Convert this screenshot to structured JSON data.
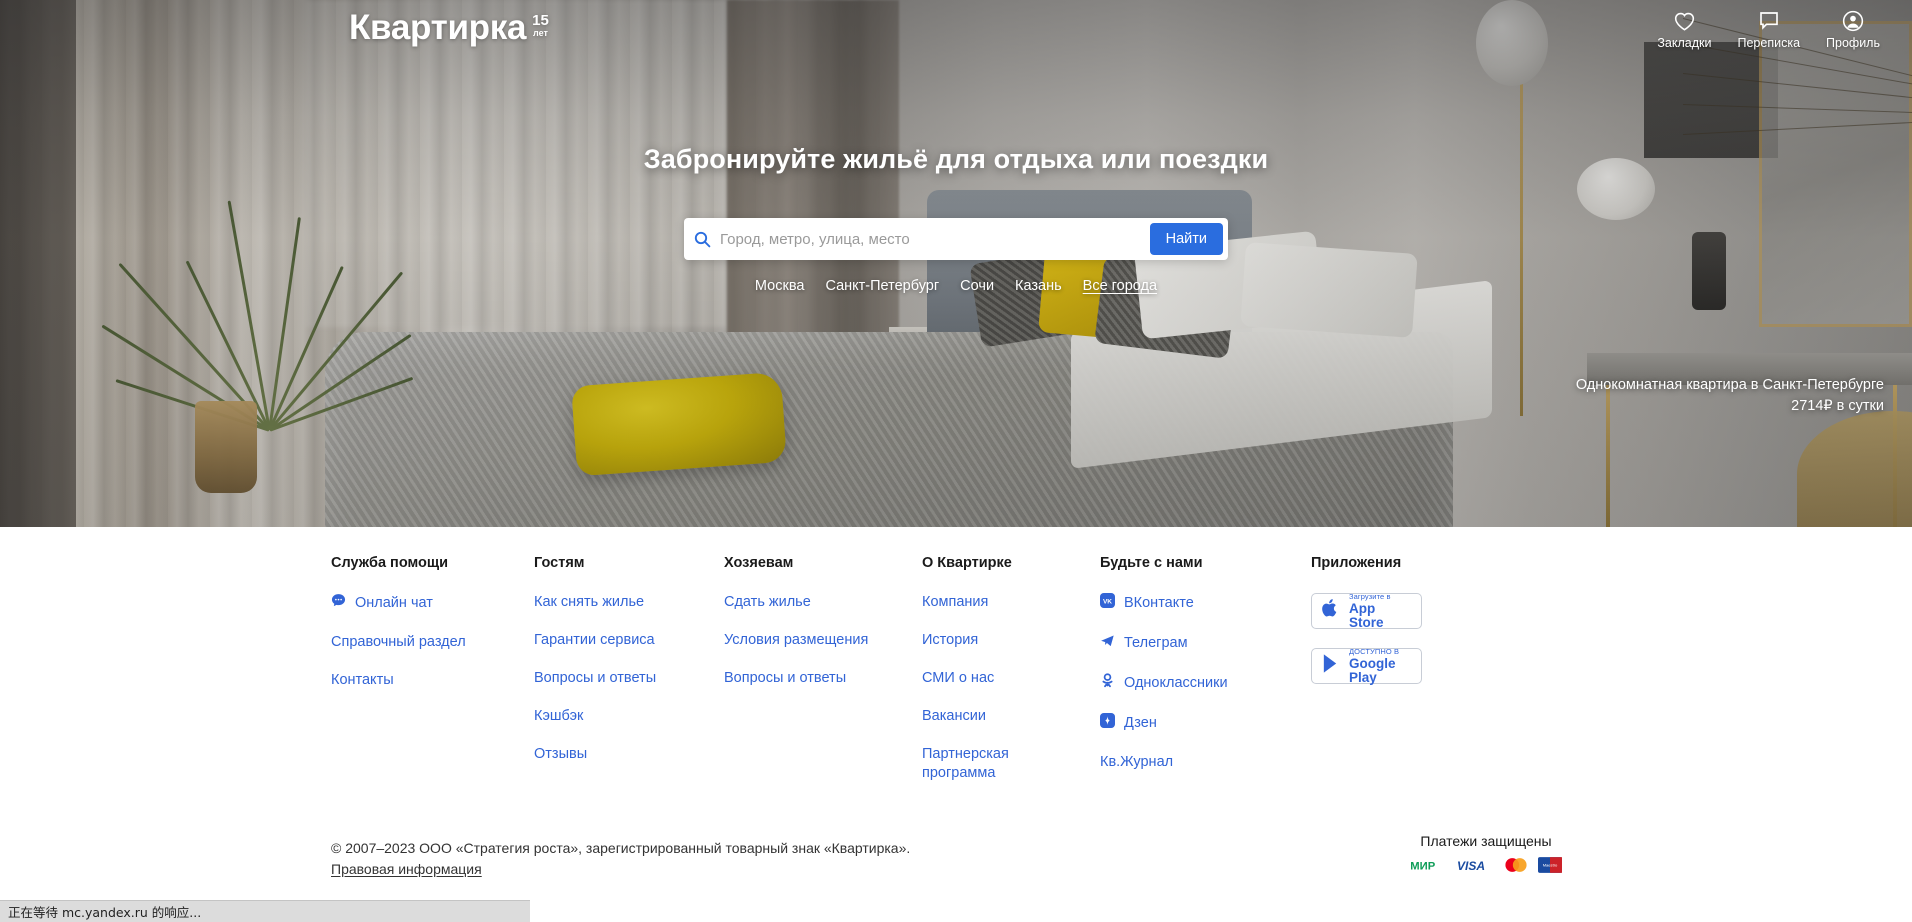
{
  "header": {
    "logo_word": "Квартирка",
    "logo_badge_number": "15",
    "logo_badge_unit": "лет",
    "nav": [
      {
        "icon": "heart-icon",
        "label": "Закладки"
      },
      {
        "icon": "chat-bubble-icon",
        "label": "Переписка"
      },
      {
        "icon": "user-circle-icon",
        "label": "Профиль"
      }
    ]
  },
  "hero": {
    "title": "Забронируйте жильё для отдыха или поездки",
    "search": {
      "icon": "search-icon",
      "placeholder": "Город, метро, улица, место",
      "value": "",
      "button_label": "Найти"
    },
    "cities": [
      "Москва",
      "Санкт-Петербург",
      "Сочи",
      "Казань",
      "Все города"
    ],
    "caption_line1": "Однокомнатная квартира в Санкт-Петербурге",
    "caption_line2": "2714₽ в сутки"
  },
  "footer": {
    "columns": [
      {
        "title": "Служба помощи",
        "links": [
          {
            "label": "Онлайн чат",
            "icon": "chat-filled-icon"
          },
          {
            "label": "Справочный раздел",
            "icon": ""
          },
          {
            "label": "Контакты",
            "icon": ""
          }
        ]
      },
      {
        "title": "Гостям",
        "links": [
          {
            "label": "Как снять жилье",
            "icon": ""
          },
          {
            "label": "Гарантии сервиса",
            "icon": ""
          },
          {
            "label": "Вопросы и ответы",
            "icon": ""
          },
          {
            "label": "Кэшбэк",
            "icon": ""
          },
          {
            "label": "Отзывы",
            "icon": ""
          }
        ]
      },
      {
        "title": "Хозяевам",
        "links": [
          {
            "label": "Сдать жилье",
            "icon": ""
          },
          {
            "label": "Условия размещения",
            "icon": ""
          },
          {
            "label": "Вопросы и ответы",
            "icon": ""
          }
        ]
      },
      {
        "title": "О Квартирке",
        "links": [
          {
            "label": "Компания",
            "icon": ""
          },
          {
            "label": "История",
            "icon": ""
          },
          {
            "label": "СМИ о нас",
            "icon": ""
          },
          {
            "label": "Вакансии",
            "icon": ""
          },
          {
            "label": "Партнерская программа",
            "icon": ""
          }
        ]
      },
      {
        "title": "Будьте с нами",
        "links": [
          {
            "label": "ВКонтакте",
            "icon": "vk-icon"
          },
          {
            "label": "Телеграм",
            "icon": "telegram-icon"
          },
          {
            "label": "Одноклассники",
            "icon": "odnoklassniki-icon"
          },
          {
            "label": "Дзен",
            "icon": "dzen-icon"
          },
          {
            "label": "Кв.Журнал",
            "icon": ""
          }
        ]
      },
      {
        "title": "Приложения",
        "badges": [
          {
            "icon": "apple-icon",
            "top": "Загрузите в",
            "main": "App Store"
          },
          {
            "icon": "google-play-icon",
            "top": "ДОСТУПНО В",
            "main": "Google Play"
          }
        ]
      }
    ],
    "legal_text": "© 2007–2023 ООО «Стратегия роста», зарегистрированный товарный знак «Квартирка».",
    "legal_link": "Правовая информация",
    "payments_title": "Платежи защищены",
    "payment_logos": [
      "МИР",
      "VISA",
      "Mastercard",
      "Maestro"
    ]
  },
  "browser": {
    "status_text": "正在等待 mc.yandex.ru 的响应..."
  },
  "colors": {
    "accent_blue": "#2a6ddf",
    "link_blue": "#3264d6",
    "white": "#ffffff"
  }
}
